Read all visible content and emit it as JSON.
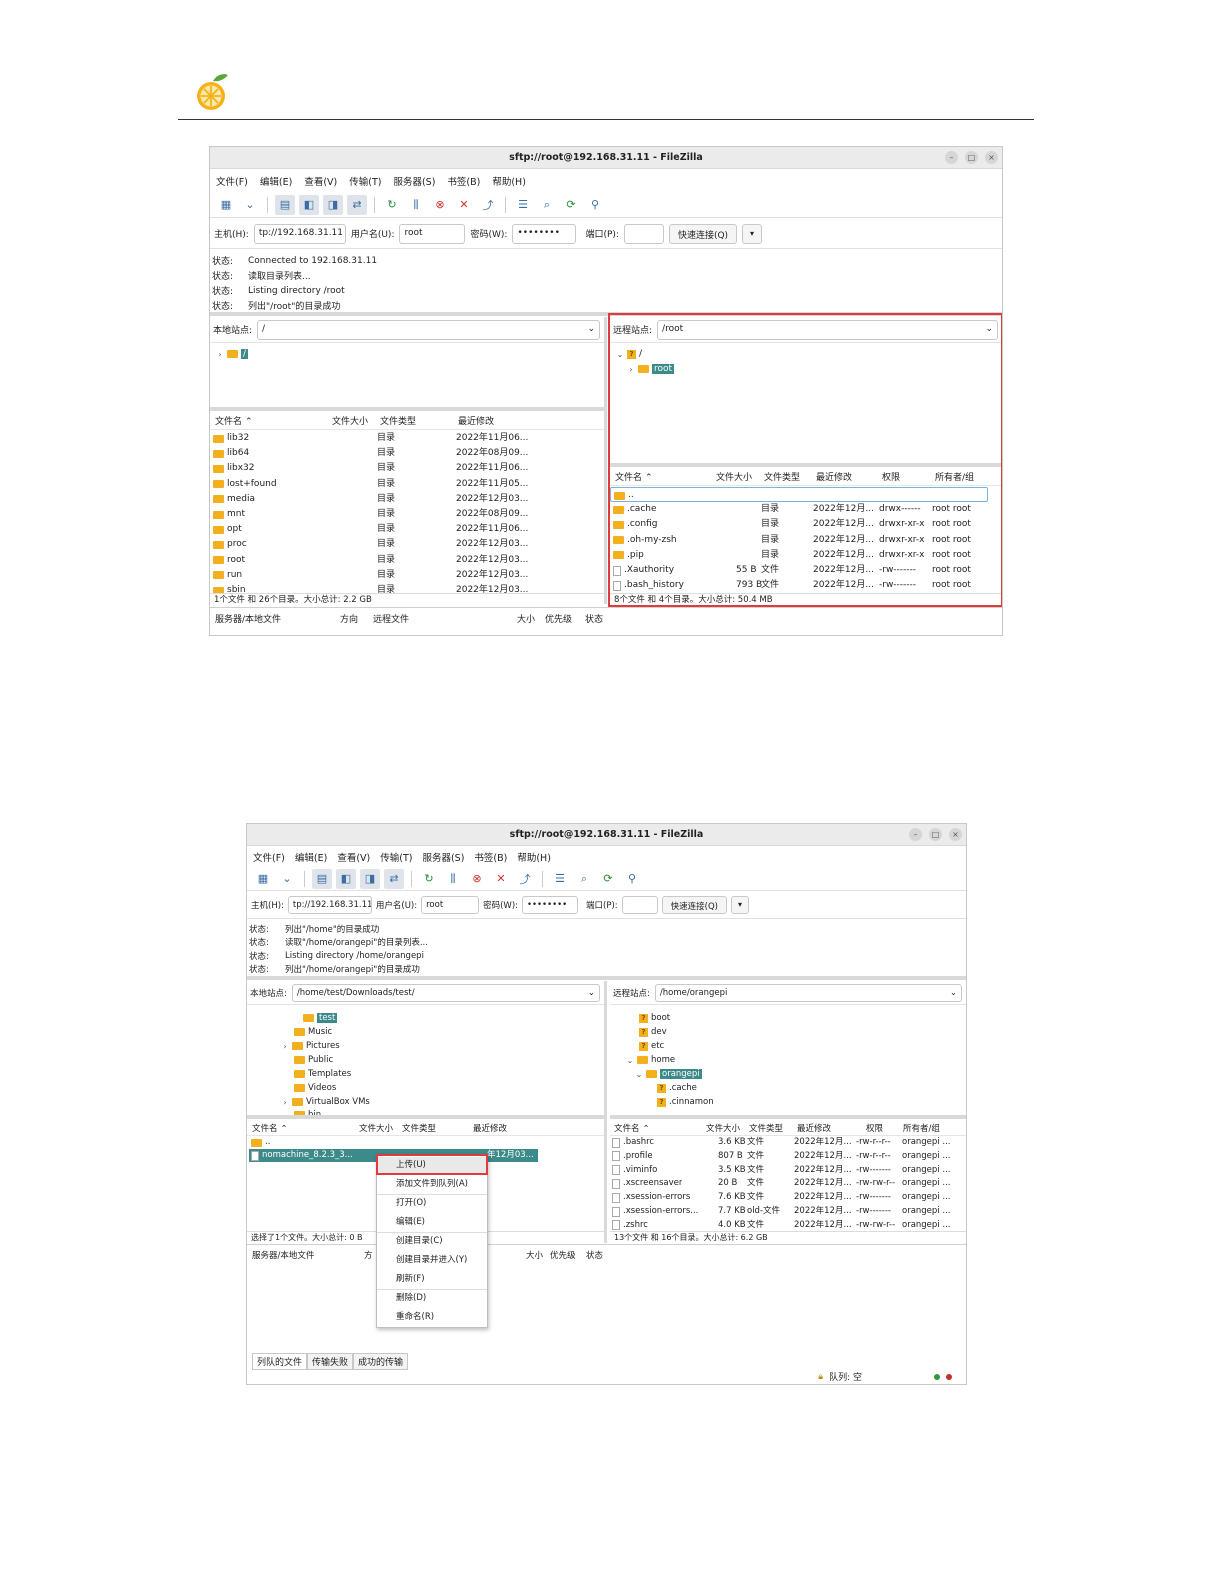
{
  "win1": {
    "title": "sftp://root@192.168.31.11 - FileZilla",
    "menu": [
      "文件(F)",
      "编辑(E)",
      "查看(V)",
      "传输(T)",
      "服务器(S)",
      "书签(B)",
      "帮助(H)"
    ],
    "quickconnect": {
      "host_label": "主机(H):",
      "host_value": "tp://192.168.31.11",
      "user_label": "用户名(U):",
      "user_value": "root",
      "pass_label": "密码(W):",
      "pass_value": "••••••••",
      "port_label": "端口(P):",
      "port_value": "",
      "connect_label": "快速连接(Q)"
    },
    "log": [
      {
        "key": "状态:",
        "text": "Connected to 192.168.31.11"
      },
      {
        "key": "状态:",
        "text": "读取目录列表..."
      },
      {
        "key": "状态:",
        "text": "Listing directory /root"
      },
      {
        "key": "状态:",
        "text": "列出\"/root\"的目录成功"
      }
    ],
    "local": {
      "site_label": "本地站点:",
      "site_value": "/",
      "tree": [
        {
          "name": "/"
        }
      ],
      "headers": [
        "文件名",
        "文件大小",
        "文件类型",
        "最近修改"
      ],
      "rows": [
        {
          "name": "lib32",
          "type": "目录",
          "modified": "2022年11月06..."
        },
        {
          "name": "lib64",
          "type": "目录",
          "modified": "2022年08月09..."
        },
        {
          "name": "libx32",
          "type": "目录",
          "modified": "2022年11月06..."
        },
        {
          "name": "lost+found",
          "type": "目录",
          "modified": "2022年11月05..."
        },
        {
          "name": "media",
          "type": "目录",
          "modified": "2022年12月03..."
        },
        {
          "name": "mnt",
          "type": "目录",
          "modified": "2022年08月09..."
        },
        {
          "name": "opt",
          "type": "目录",
          "modified": "2022年11月06..."
        },
        {
          "name": "proc",
          "type": "目录",
          "modified": "2022年12月03..."
        },
        {
          "name": "root",
          "type": "目录",
          "modified": "2022年12月03..."
        },
        {
          "name": "run",
          "type": "目录",
          "modified": "2022年12月03..."
        },
        {
          "name": "sbin",
          "type": "目录",
          "modified": "2022年12月03..."
        }
      ],
      "summary": "1个文件 和 26个目录。大小总计: 2.2 GB"
    },
    "remote": {
      "site_label": "远程站点:",
      "site_value": "/root",
      "tree": [
        {
          "name": "/"
        },
        {
          "name": "root"
        }
      ],
      "headers": [
        "文件名",
        "文件大小",
        "文件类型",
        "最近修改",
        "权限",
        "所有者/组"
      ],
      "rows": [
        {
          "name": "..",
          "size": "",
          "type": "",
          "modified": "",
          "perm": "",
          "owner": "",
          "kind": "folder"
        },
        {
          "name": ".cache",
          "size": "",
          "type": "目录",
          "modified": "2022年12月...",
          "perm": "drwx------",
          "owner": "root root",
          "kind": "folder"
        },
        {
          "name": ".config",
          "size": "",
          "type": "目录",
          "modified": "2022年12月...",
          "perm": "drwxr-xr-x",
          "owner": "root root",
          "kind": "folder"
        },
        {
          "name": ".oh-my-zsh",
          "size": "",
          "type": "目录",
          "modified": "2022年12月...",
          "perm": "drwxr-xr-x",
          "owner": "root root",
          "kind": "folder"
        },
        {
          "name": ".pip",
          "size": "",
          "type": "目录",
          "modified": "2022年12月...",
          "perm": "drwxr-xr-x",
          "owner": "root root",
          "kind": "folder"
        },
        {
          "name": ".Xauthority",
          "size": "55 B",
          "type": "文件",
          "modified": "2022年12月...",
          "perm": "-rw-------",
          "owner": "root root",
          "kind": "file"
        },
        {
          "name": ".bash_history",
          "size": "793 B",
          "type": "文件",
          "modified": "2022年12月...",
          "perm": "-rw-------",
          "owner": "root root",
          "kind": "file"
        }
      ],
      "summary": "8个文件 和 4个目录。大小总计: 50.4 MB"
    },
    "queue_headers": [
      "服务器/本地文件",
      "方向",
      "远程文件",
      "大小",
      "优先级",
      "状态"
    ]
  },
  "win2": {
    "title": "sftp://root@192.168.31.11 - FileZilla",
    "menu": [
      "文件(F)",
      "编辑(E)",
      "查看(V)",
      "传输(T)",
      "服务器(S)",
      "书签(B)",
      "帮助(H)"
    ],
    "quickconnect": {
      "host_label": "主机(H):",
      "host_value": "tp://192.168.31.11",
      "user_label": "用户名(U):",
      "user_value": "root",
      "pass_label": "密码(W):",
      "pass_value": "••••••••",
      "port_label": "端口(P):",
      "port_value": "",
      "connect_label": "快速连接(Q)"
    },
    "log": [
      {
        "key": "状态:",
        "text": "列出\"/home\"的目录成功"
      },
      {
        "key": "状态:",
        "text": "读取\"/home/orangepi\"的目录列表..."
      },
      {
        "key": "状态:",
        "text": "Listing directory /home/orangepi"
      },
      {
        "key": "状态:",
        "text": "列出\"/home/orangepi\"的目录成功"
      }
    ],
    "local": {
      "site_label": "本地站点:",
      "site_value": "/home/test/Downloads/test/",
      "tree": [
        {
          "name": "test"
        },
        {
          "name": "Music"
        },
        {
          "name": "Pictures"
        },
        {
          "name": "Public"
        },
        {
          "name": "Templates"
        },
        {
          "name": "Videos"
        },
        {
          "name": "VirtualBox VMs"
        },
        {
          "name": "bin"
        }
      ],
      "headers": [
        "文件名",
        "文件大小",
        "文件类型",
        "最近修改"
      ],
      "rows": [
        {
          "name": ".."
        },
        {
          "name": "nomachine_8.2.3_3...",
          "modified": "年12月03..."
        }
      ],
      "summary": "选择了1个文件。大小总计: 0 B"
    },
    "remote": {
      "site_label": "远程站点:",
      "site_value": "/home/orangepi",
      "tree": [
        {
          "name": "boot"
        },
        {
          "name": "dev"
        },
        {
          "name": "etc"
        },
        {
          "name": "home"
        },
        {
          "name": "orangepi"
        },
        {
          "name": ".cache"
        },
        {
          "name": ".cinnamon"
        }
      ],
      "headers": [
        "文件名",
        "文件大小",
        "文件类型",
        "最近修改",
        "权限",
        "所有者/组"
      ],
      "rows": [
        {
          "name": ".bashrc",
          "size": "3.6 KB",
          "type": "文件",
          "modified": "2022年12月...",
          "perm": "-rw-r--r--",
          "owner": "orangepi ..."
        },
        {
          "name": ".profile",
          "size": "807 B",
          "type": "文件",
          "modified": "2022年12月...",
          "perm": "-rw-r--r--",
          "owner": "orangepi ..."
        },
        {
          "name": ".viminfo",
          "size": "3.5 KB",
          "type": "文件",
          "modified": "2022年12月...",
          "perm": "-rw-------",
          "owner": "orangepi ..."
        },
        {
          "name": ".xscreensaver",
          "size": "20 B",
          "type": "文件",
          "modified": "2022年12月...",
          "perm": "-rw-rw-r--",
          "owner": "orangepi ..."
        },
        {
          "name": ".xsession-errors",
          "size": "7.6 KB",
          "type": "文件",
          "modified": "2022年12月...",
          "perm": "-rw-------",
          "owner": "orangepi ..."
        },
        {
          "name": ".xsession-errors...",
          "size": "7.7 KB",
          "type": "old-文件",
          "modified": "2022年12月...",
          "perm": "-rw-------",
          "owner": "orangepi ..."
        },
        {
          "name": ".zshrc",
          "size": "4.0 KB",
          "type": "文件",
          "modified": "2022年12月...",
          "perm": "-rw-rw-r--",
          "owner": "orangepi ..."
        }
      ],
      "summary": "13个文件 和 16个目录。大小总计: 6.2 GB"
    },
    "context_menu": [
      "上传(U)",
      "添加文件到队列(A)",
      "打开(O)",
      "编辑(E)",
      "创建目录(C)",
      "创建目录并进入(Y)",
      "刷新(F)",
      "删除(D)",
      "重命名(R)"
    ],
    "queue_headers": [
      "服务器/本地文件",
      "方",
      "大小",
      "优先级",
      "状态"
    ],
    "tabs": [
      "列队的文件",
      "传输失败",
      "成功的传输"
    ],
    "status": "队列: 空"
  },
  "colors": {
    "highlight": "#e03a3a",
    "selection": "#3d8a8a",
    "folder": "#f2b01e"
  }
}
